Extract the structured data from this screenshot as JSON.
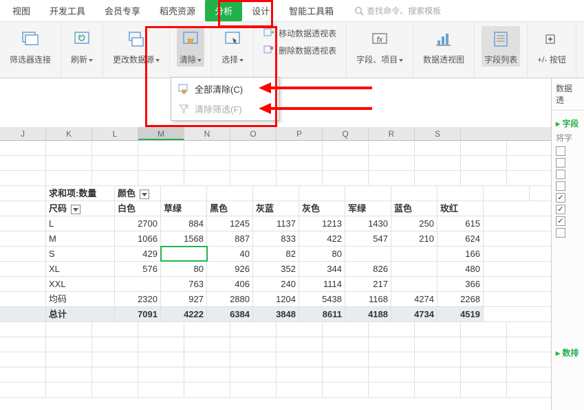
{
  "menu": {
    "items": [
      "视图",
      "开发工具",
      "会员专享",
      "稻壳资源",
      "分析",
      "设计",
      "智能工具箱"
    ],
    "active_index": 4,
    "search_placeholder": "查找命令、搜索模板"
  },
  "ribbon": {
    "slicer": "筛选器连接",
    "refresh": "刷新",
    "change_source": "更改数据源",
    "clear": "清除",
    "select": "选择",
    "move_pivot": "移动数据透视表",
    "delete_pivot": "删除数据透视表",
    "fields": "字段、项目",
    "pivot_chart": "数据透视图",
    "field_list": "字段列表",
    "buttons": "+/- 按钮"
  },
  "dropdown": {
    "clear_all": "全部清除(C)",
    "clear_filter": "清除筛选(F)"
  },
  "cols": [
    "J",
    "K",
    "L",
    "M",
    "N",
    "O",
    "P",
    "Q",
    "R",
    "S"
  ],
  "selected_col_index": 3,
  "pivot": {
    "sum_label": "求和项:数量",
    "color_label": "颜色",
    "size_label": "尺码",
    "headers": [
      "白色",
      "草绿",
      "黑色",
      "灰蓝",
      "灰色",
      "军绿",
      "蓝色",
      "玫红"
    ],
    "rows": [
      {
        "label": "L",
        "v": [
          2700,
          884,
          1245,
          1137,
          1213,
          1430,
          250,
          615
        ]
      },
      {
        "label": "M",
        "v": [
          1066,
          1568,
          887,
          833,
          422,
          547,
          210,
          624
        ]
      },
      {
        "label": "S",
        "v": [
          429,
          null,
          40,
          82,
          80,
          null,
          null,
          166
        ]
      },
      {
        "label": "XL",
        "v": [
          576,
          80,
          926,
          352,
          344,
          826,
          null,
          480
        ]
      },
      {
        "label": "XXL",
        "v": [
          null,
          763,
          406,
          240,
          1114,
          217,
          null,
          366
        ]
      },
      {
        "label": "均码",
        "v": [
          2320,
          927,
          2880,
          1204,
          5438,
          1168,
          4274,
          2268
        ]
      }
    ],
    "total_label": "总计",
    "totals": [
      7091,
      4222,
      6384,
      3848,
      8611,
      4188,
      4734,
      4519
    ]
  },
  "panel": {
    "title": "数据透",
    "fields_label": "字段",
    "drag_hint": "将字",
    "data_label": "数排"
  }
}
